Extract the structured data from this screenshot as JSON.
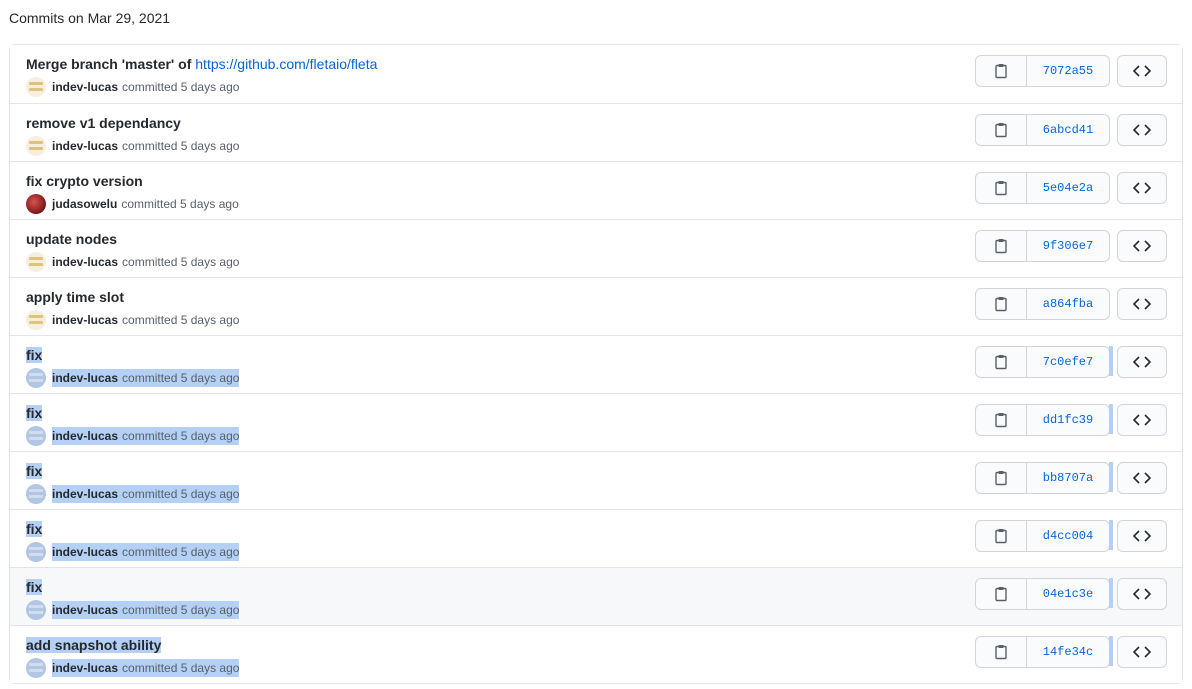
{
  "group_title": "Commits on Mar 29, 2021",
  "committed_word": "committed",
  "commits": [
    {
      "message": "Merge branch 'master' of ",
      "link": "https://github.com/fletaio/fleta",
      "author": "indev-lucas",
      "time": "5 days ago",
      "sha": "7072a55",
      "avatar": "id",
      "selected": false
    },
    {
      "message": "remove v1 dependancy",
      "link": "",
      "author": "indev-lucas",
      "time": "5 days ago",
      "sha": "6abcd41",
      "avatar": "id",
      "selected": false
    },
    {
      "message": "fix crypto version",
      "link": "",
      "author": "judasowelu",
      "time": "5 days ago",
      "sha": "5e04e2a",
      "avatar": "judas",
      "selected": false
    },
    {
      "message": "update nodes",
      "link": "",
      "author": "indev-lucas",
      "time": "5 days ago",
      "sha": "9f306e7",
      "avatar": "id",
      "selected": false
    },
    {
      "message": "apply time slot",
      "link": "",
      "author": "indev-lucas",
      "time": "5 days ago",
      "sha": "a864fba",
      "avatar": "id",
      "selected": false
    },
    {
      "message": "fix",
      "link": "",
      "author": "indev-lucas",
      "time": "5 days ago",
      "sha": "7c0efe7",
      "avatar": "sel",
      "selected": true
    },
    {
      "message": "fix",
      "link": "",
      "author": "indev-lucas",
      "time": "5 days ago",
      "sha": "dd1fc39",
      "avatar": "sel",
      "selected": true
    },
    {
      "message": "fix",
      "link": "",
      "author": "indev-lucas",
      "time": "5 days ago",
      "sha": "bb8707a",
      "avatar": "sel",
      "selected": true
    },
    {
      "message": "fix",
      "link": "",
      "author": "indev-lucas",
      "time": "5 days ago",
      "sha": "d4cc004",
      "avatar": "sel",
      "selected": true
    },
    {
      "message": "fix",
      "link": "",
      "author": "indev-lucas",
      "time": "5 days ago",
      "sha": "04e1c3e",
      "avatar": "sel",
      "selected": true,
      "hover": true
    },
    {
      "message": "add snapshot ability",
      "link": "",
      "author": "indev-lucas",
      "time": "5 days ago",
      "sha": "14fe34c",
      "avatar": "sel",
      "selected": true
    }
  ],
  "icons": {
    "copy": "clipboard-icon",
    "browse": "code-icon"
  },
  "colors": {
    "link": "#0366d6",
    "selection": "#b4d1f5",
    "border": "#d1d5da"
  }
}
